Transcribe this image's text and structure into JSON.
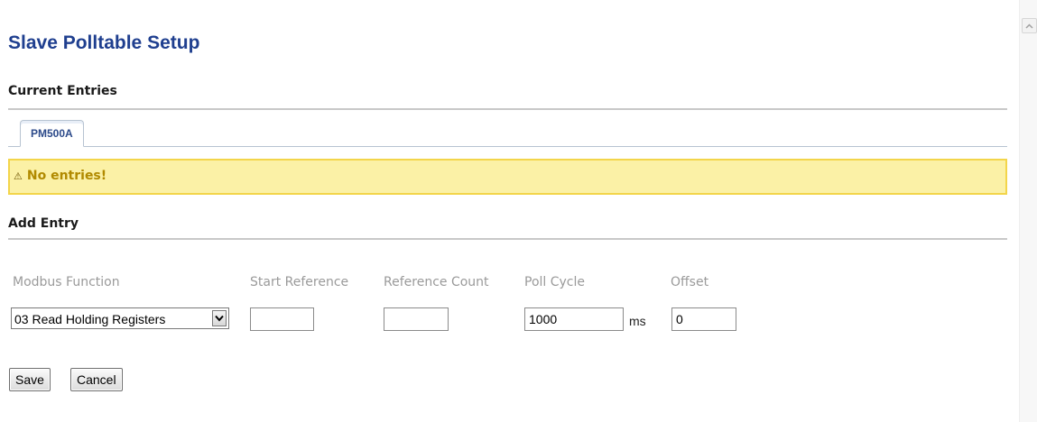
{
  "page": {
    "title": "Slave Polltable Setup"
  },
  "current_entries": {
    "heading": "Current Entries",
    "tabs": [
      {
        "label": "PM500A",
        "active": true
      }
    ],
    "warning": {
      "icon": "warning-triangle-icon",
      "text": "No entries!"
    }
  },
  "add_entry": {
    "heading": "Add Entry",
    "labels": {
      "modbus_function": "Modbus Function",
      "start_reference": "Start Reference",
      "reference_count": "Reference Count",
      "poll_cycle": "Poll Cycle",
      "offset": "Offset"
    },
    "modbus_function": {
      "selected": "03 Read Holding Registers"
    },
    "start_reference": {
      "value": ""
    },
    "reference_count": {
      "value": ""
    },
    "poll_cycle": {
      "value": "1000",
      "unit": "ms"
    },
    "offset": {
      "value": "0"
    }
  },
  "buttons": {
    "save": "Save",
    "cancel": "Cancel"
  },
  "colors": {
    "title": "#1f3f8f",
    "tab_text": "#2c4a8a",
    "warning_bg": "#fbf1a6",
    "warning_border": "#f3d54a",
    "warning_text": "#b18a00"
  }
}
